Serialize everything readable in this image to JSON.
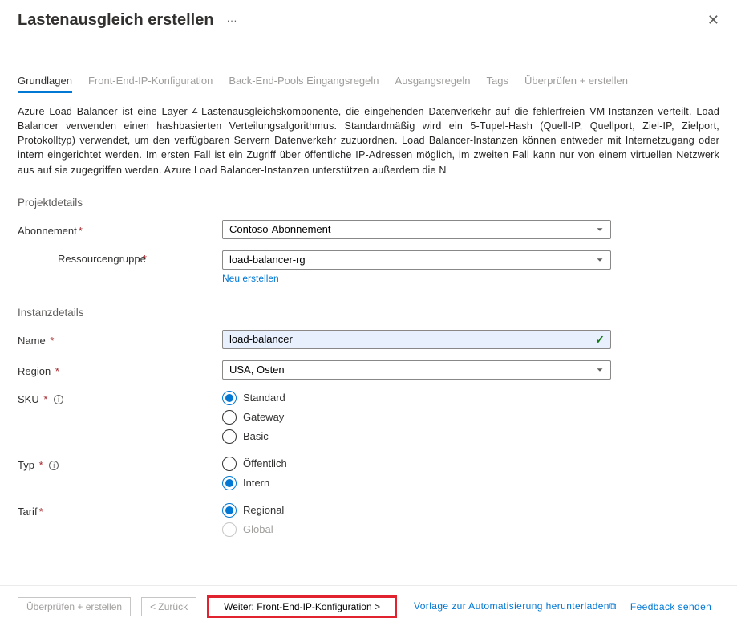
{
  "title": "Lastenausgleich erstellen",
  "ellipsis": "···",
  "close": "✕",
  "tabs": {
    "items": [
      {
        "label": "Grundlagen",
        "active": true
      },
      {
        "label": "Front-End-IP-Konfiguration",
        "active": false
      },
      {
        "label": "Back-End-Pools",
        "active": false
      },
      {
        "label": "Eingangsregeln",
        "active": false
      },
      {
        "label": "Ausgangsregeln",
        "active": false
      },
      {
        "label": "Tags",
        "active": false
      },
      {
        "label": "Überprüfen + erstellen",
        "active": false
      }
    ]
  },
  "description": "Azure Load Balancer ist eine Layer 4-Lastenausgleichskomponente, die eingehenden Datenverkehr auf die fehlerfreien VM-Instanzen verteilt. Load Balancer verwenden einen hashbasierten Verteilungsalgorithmus. Standardmäßig wird ein 5-Tupel-Hash (Quell-IP, Quellport, Ziel-IP, Zielport, Protokolltyp) verwendet, um den verfügbaren Servern Datenverkehr zuzuordnen. Load Balancer-Instanzen können entweder mit Internetzugang oder intern eingerichtet werden. Im ersten Fall ist ein Zugriff über öffentliche IP-Adressen möglich, im zweiten Fall kann nur von einem virtuellen Netzwerk aus auf sie zugegriffen werden. Azure Load Balancer-Instanzen unterstützen außerdem die N",
  "sections": {
    "project": "Projektdetails",
    "instance": "Instanzdetails"
  },
  "fields": {
    "subscription": {
      "label": "Abonnement",
      "value": "Contoso-Abonnement"
    },
    "resource_group": {
      "label": "Ressourcengruppe",
      "value": "load-balancer-rg",
      "new_link": "Neu erstellen"
    },
    "name": {
      "label": "Name",
      "value": "load-balancer"
    },
    "region": {
      "label": "Region",
      "value": "USA, Osten"
    },
    "sku": {
      "label": "SKU",
      "options": [
        {
          "label": "Standard",
          "selected": true
        },
        {
          "label": "Gateway",
          "selected": false
        },
        {
          "label": "Basic",
          "selected": false
        }
      ]
    },
    "type": {
      "label": "Typ",
      "options": [
        {
          "label": "Öffentlich",
          "selected": false
        },
        {
          "label": "Intern",
          "selected": true
        }
      ]
    },
    "tier": {
      "label": "Tarif",
      "options": [
        {
          "label": "Regional",
          "selected": true,
          "disabled": false
        },
        {
          "label": "Global",
          "selected": false,
          "disabled": true
        }
      ]
    }
  },
  "footer": {
    "review": "Überprüfen + erstellen",
    "back": "<  Zurück",
    "next_prefix": "Weiter:",
    "next_target": "Front-End-IP-Konfiguration  >",
    "template_link": "Vorlage zur Automatisierung herunterladen",
    "feedback": "Feedback senden"
  }
}
